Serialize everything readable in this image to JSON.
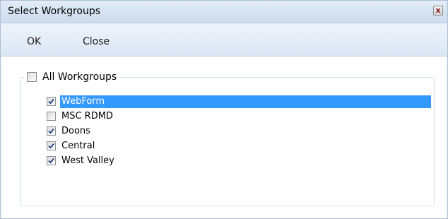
{
  "window": {
    "title": "Select Workgroups",
    "close_glyph": "x"
  },
  "toolbar": {
    "ok_label": "OK",
    "close_label": "Close"
  },
  "group": {
    "all_label": "All Workgroups",
    "all_checked": false,
    "items": [
      {
        "label": "WebForm",
        "checked": true,
        "selected": true
      },
      {
        "label": "MSC RDMD",
        "checked": false,
        "selected": false
      },
      {
        "label": "Doons",
        "checked": true,
        "selected": false
      },
      {
        "label": "Central",
        "checked": true,
        "selected": false
      },
      {
        "label": "West Valley",
        "checked": true,
        "selected": false
      }
    ]
  },
  "colors": {
    "selection": "#3399ff",
    "check": "#1c3c7a"
  }
}
